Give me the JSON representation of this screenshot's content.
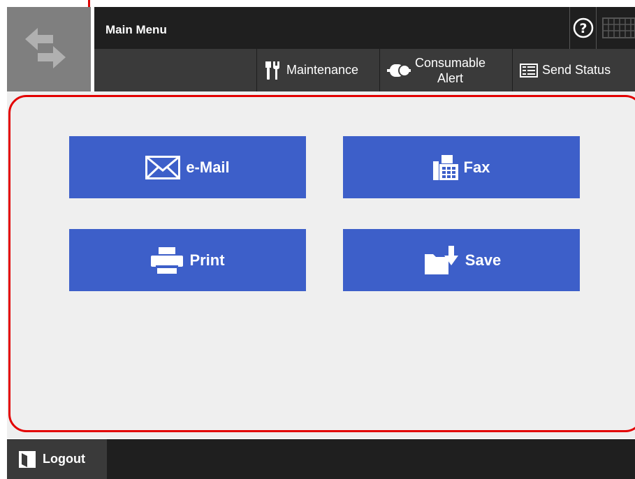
{
  "header": {
    "title": "Main Menu",
    "help_glyph": "?"
  },
  "toolbar": {
    "maintenance_label": "Maintenance",
    "consumable_line1": "Consumable",
    "consumable_line2": "Alert",
    "send_status_label": "Send Status"
  },
  "menu": {
    "email_label": "e-Mail",
    "fax_label": "Fax",
    "print_label": "Print",
    "save_label": "Save"
  },
  "footer": {
    "logout_label": "Logout"
  },
  "colors": {
    "button_blue": "#3d5fc9",
    "highlight_red": "#e30000",
    "panel_bg": "#efefef",
    "topbar_dark": "#1f1f1f"
  },
  "icons": [
    "switch-arrows-icon",
    "help-icon",
    "keyboard-icon",
    "maintenance-tools-icon",
    "toner-icon",
    "send-status-list-icon",
    "envelope-icon",
    "fax-machine-icon",
    "printer-icon",
    "save-folder-icon",
    "logout-door-icon"
  ]
}
